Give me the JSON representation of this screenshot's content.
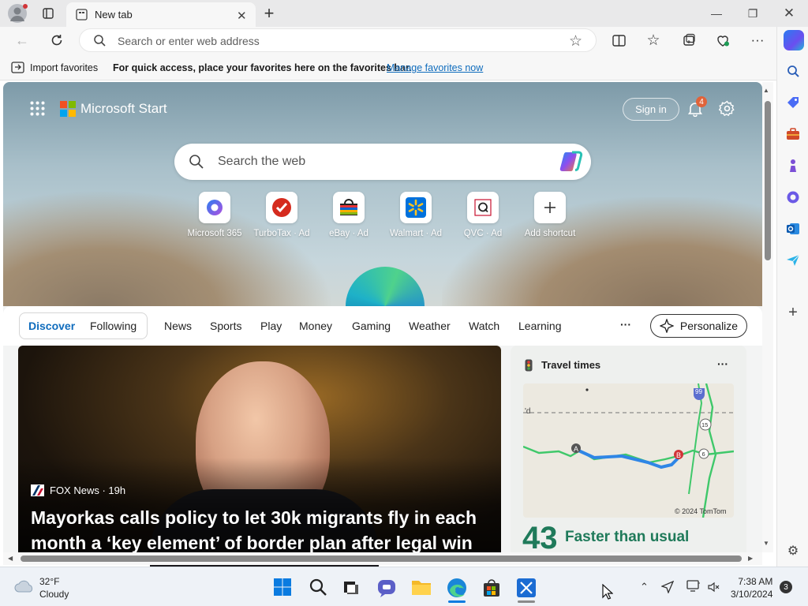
{
  "browser": {
    "tab_title": "New tab",
    "address_placeholder": "Search or enter web address"
  },
  "favorites_bar": {
    "import_label": "Import favorites",
    "message": "For quick access, place your favorites here on the favorites bar.",
    "manage_link": "Manage favorites now"
  },
  "start": {
    "brand": "Microsoft Start",
    "sign_in": "Sign in",
    "notification_count": "4",
    "search_placeholder": "Search the web",
    "shortcuts": [
      {
        "label": "Microsoft 365",
        "icon": "microsoft-365-icon"
      },
      {
        "label": "TurboTax · Ad",
        "icon": "turbotax-icon"
      },
      {
        "label": "eBay · Ad",
        "icon": "ebay-icon"
      },
      {
        "label": "Walmart · Ad",
        "icon": "walmart-icon"
      },
      {
        "label": "QVC · Ad",
        "icon": "qvc-icon"
      },
      {
        "label": "Add shortcut",
        "icon": "plus-icon"
      }
    ]
  },
  "feed_nav": {
    "tabs": [
      "Discover",
      "Following",
      "News",
      "Sports",
      "Play",
      "Money",
      "Gaming",
      "Weather",
      "Watch",
      "Learning"
    ],
    "active_tab": "Discover",
    "more": "···",
    "personalize": "Personalize"
  },
  "lead_story": {
    "source": "FOX News · 19h",
    "headline": "Mayorkas calls policy to let 30k migrants fly in each month a ‘key element’ of border plan after legal win"
  },
  "travel_card": {
    "title": "Travel times",
    "more": "···",
    "route_labels": [
      "99",
      "15",
      "6"
    ],
    "map_credit": "© 2024 TomTom",
    "minutes": "43",
    "status": "Faster than usual"
  },
  "taskbar": {
    "weather_temp": "32°F",
    "weather_desc": "Cloudy",
    "time": "7:38 AM",
    "date": "3/10/2024",
    "notifications": "3"
  },
  "colors": {
    "accent": "#0f6cbd",
    "travel_green": "#1f7a5a",
    "route_blue": "#2f86e6"
  }
}
